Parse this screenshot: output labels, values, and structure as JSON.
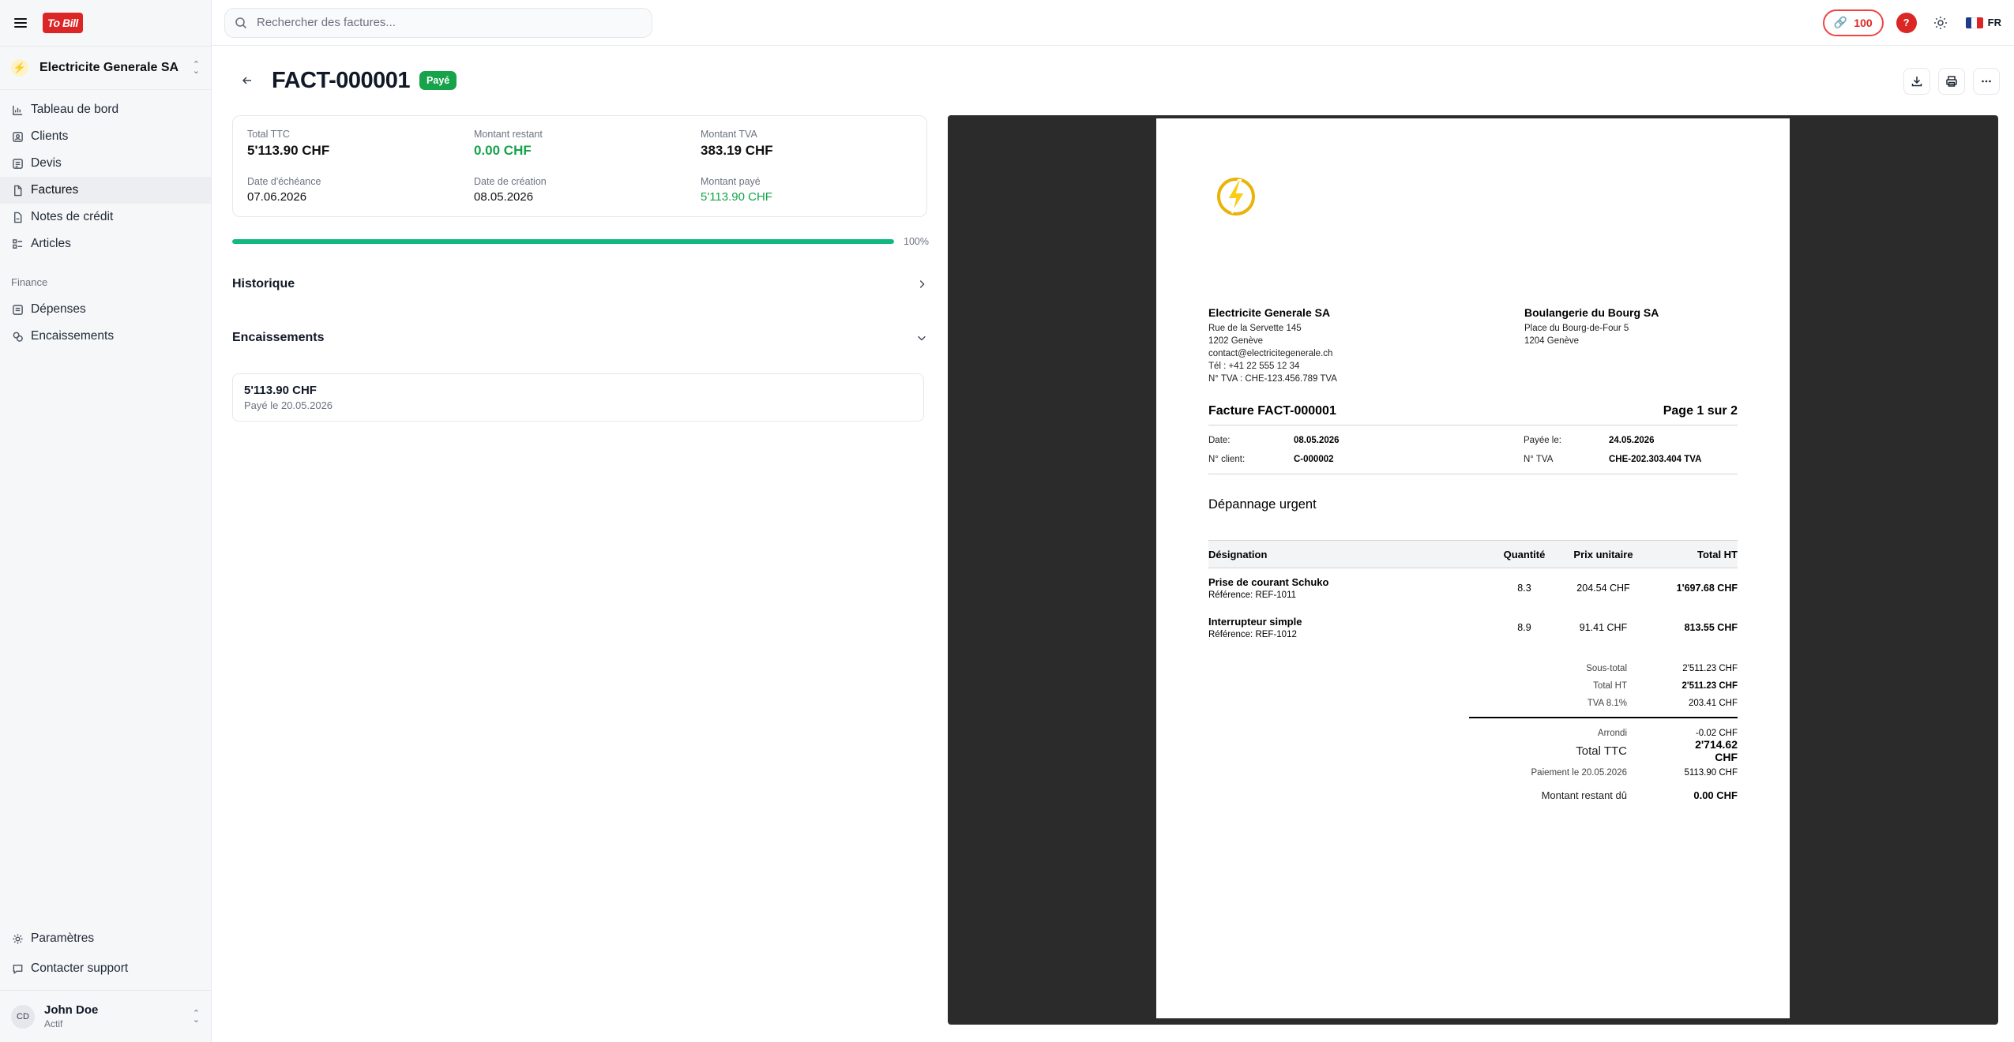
{
  "sidebar": {
    "logo": "To Bill",
    "org_name": "Electricite Generale SA",
    "items": [
      {
        "label": "Tableau de bord",
        "icon": "chart-icon"
      },
      {
        "label": "Clients",
        "icon": "user-icon"
      },
      {
        "label": "Devis",
        "icon": "quote-icon"
      },
      {
        "label": "Factures",
        "icon": "file-icon",
        "active": true
      },
      {
        "label": "Notes de crédit",
        "icon": "credit-note-icon"
      },
      {
        "label": "Articles",
        "icon": "list-icon"
      }
    ],
    "finance_label": "Finance",
    "finance_items": [
      {
        "label": "Dépenses",
        "icon": "wallet-icon"
      },
      {
        "label": "Encaissements",
        "icon": "coins-icon"
      }
    ],
    "bottom_items": [
      {
        "label": "Paramètres",
        "icon": "gear-icon"
      },
      {
        "label": "Contacter support",
        "icon": "chat-icon"
      }
    ],
    "user": {
      "initials": "CD",
      "name": "John Doe",
      "status": "Actif"
    }
  },
  "topbar": {
    "search_placeholder": "Rechercher des factures...",
    "credits": "100",
    "help": "?",
    "language": "FR"
  },
  "invoice": {
    "number": "FACT-000001",
    "status": "Payé",
    "summary": {
      "total_ttc_label": "Total TTC",
      "total_ttc": "5'113.90 CHF",
      "remaining_label": "Montant restant",
      "remaining": "0.00 CHF",
      "tva_label": "Montant TVA",
      "tva": "383.19 CHF",
      "due_label": "Date d'échéance",
      "due": "07.06.2026",
      "created_label": "Date de création",
      "created": "08.05.2026",
      "paid_label": "Montant payé",
      "paid": "5'113.90 CHF"
    },
    "progress_fraction": 1.0,
    "progress_text": "100%",
    "history_label": "Historique",
    "payments_label": "Encaissements",
    "payments": [
      {
        "amount": "5'113.90 CHF",
        "date": "Payé le 20.05.2026"
      }
    ]
  },
  "document": {
    "sender": {
      "name": "Electricite Generale SA",
      "street": "Rue de la Servette 145",
      "city": "1202 Genève",
      "email": "contact@electricitegenerale.ch",
      "phone": "Tél : +41 22 555 12 34",
      "vat": "N° TVA : CHE-123.456.789 TVA"
    },
    "recipient": {
      "name": "Boulangerie du Bourg SA",
      "street": "Place du Bourg-de-Four 5",
      "city": "1204 Genève"
    },
    "title": "Facture FACT-000001",
    "page": "Page 1 sur 2",
    "meta": {
      "date_label": "Date:",
      "date": "08.05.2026",
      "paid_label": "Payée le:",
      "paid": "24.05.2026",
      "client_label": "N° client:",
      "client": "C-000002",
      "vat_label": "N° TVA",
      "vat": "CHE-202.303.404 TVA"
    },
    "subject": "Dépannage urgent",
    "columns": {
      "designation": "Désignation",
      "quantity": "Quantité",
      "unit_price": "Prix unitaire",
      "total": "Total HT"
    },
    "items": [
      {
        "name": "Prise de courant Schuko",
        "ref": "Référence: REF-1011",
        "qty": "8.3",
        "unit": "204.54 CHF",
        "total": "1'697.68 CHF"
      },
      {
        "name": "Interrupteur simple",
        "ref": "Référence: REF-1012",
        "qty": "8.9",
        "unit": "91.41 CHF",
        "total": "813.55 CHF"
      }
    ],
    "totals": {
      "subtotal_label": "Sous-total",
      "subtotal": "2'511.23 CHF",
      "total_ht_label": "Total HT",
      "total_ht": "2'511.23 CHF",
      "tva_label": "TVA 8.1%",
      "tva": "203.41 CHF",
      "rounding_label": "Arrondi",
      "rounding": "-0.02 CHF",
      "total_ttc_label": "Total TTC",
      "total_ttc": "2'714.62 CHF",
      "payment_label": "Paiement le 20.05.2026",
      "payment": "5113.90 CHF",
      "due_label": "Montant restant dû",
      "due": "0.00 CHF"
    }
  },
  "colors": {
    "brand": "#dc2626",
    "success": "#16a34a",
    "progress": "#10b981",
    "preview_bg": "#2b2b2b"
  }
}
